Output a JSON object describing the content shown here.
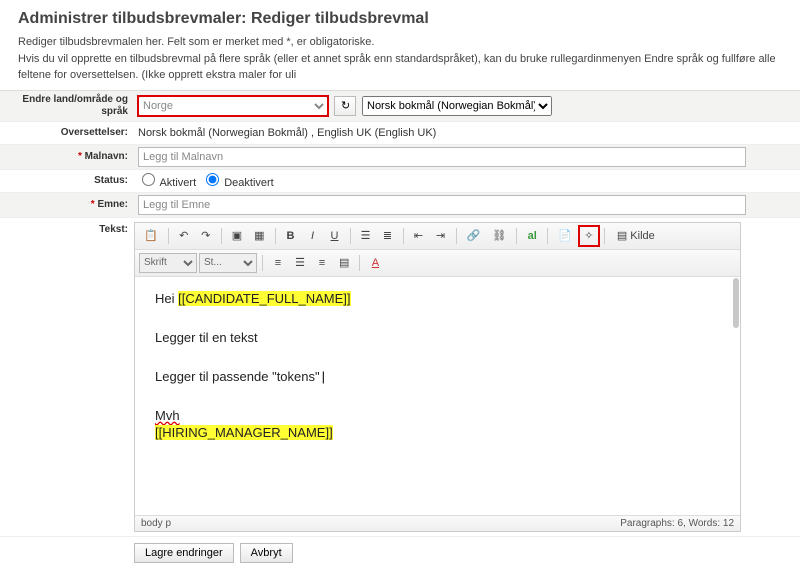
{
  "title": "Administrer tilbudsbrevmaler: Rediger tilbudsbrevmal",
  "intro1": "Rediger tilbudsbrevmalen her. Felt som er merket med *, er obligatoriske.",
  "intro2": "Hvis du vil opprette en tilbudsbrevmal på flere språk (eller et annet språk enn standardspråket), kan du bruke rullegardinmenyen Endre språk og fullføre alle feltene for oversettelsen. (Ikke opprett ekstra maler for uli",
  "labels": {
    "country": "Endre land/område og språk",
    "translations": "Oversettelser:",
    "malname": "Malnavn:",
    "status": "Status:",
    "subject": "Emne:",
    "text": "Tekst:"
  },
  "country_value": "Norge",
  "language_value": "Norsk bokmål (Norwegian Bokmål)",
  "translations_value": "Norsk bokmål (Norwegian Bokmål) , English UK (English UK)",
  "placeholders": {
    "malname": "Legg til Malnavn",
    "subject": "Legg til Emne"
  },
  "status": {
    "activated": "Aktivert",
    "deactivated": "Deaktivert",
    "selected": "deactivated"
  },
  "toolbar": {
    "font_label": "Skrift",
    "size_label": "St...",
    "source_label": "Kilde"
  },
  "body": {
    "greeting_prefix": "Hei ",
    "token_candidate": "[[CANDIDATE_FULL_NAME]]",
    "line2": "Legger til en tekst",
    "line3": "Legger til passende \"tokens\"",
    "closing": "Mvh",
    "token_manager": "[[HIRING_MANAGER_NAME]]"
  },
  "statusbar": {
    "path": "body  p",
    "stats": "Paragraphs: 6, Words: 12"
  },
  "buttons": {
    "save": "Lagre endringer",
    "cancel": "Avbryt"
  }
}
